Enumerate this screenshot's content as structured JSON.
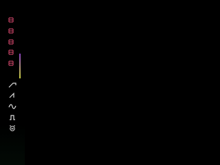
{
  "colors": {
    "background": "#000000",
    "channel_icon_stroke": "#e34c74",
    "wave_icon_stroke": "#dcdcdc",
    "meter_top": "#8b3fc2",
    "meter_bottom": "#c8d23e",
    "top_strip": "#0b3a16"
  },
  "sidebar": {
    "channel_buttons": [
      {
        "icon": "channel-icon"
      },
      {
        "icon": "channel-icon"
      },
      {
        "icon": "channel-icon"
      },
      {
        "icon": "channel-icon"
      },
      {
        "icon": "channel-icon"
      }
    ],
    "level_meter": {
      "level": 1.0
    },
    "waveform_buttons": [
      {
        "icon": "sawtooth-wave-icon"
      },
      {
        "icon": "ramp-wave-icon"
      },
      {
        "icon": "sine-wave-icon"
      },
      {
        "icon": "square-wave-icon"
      },
      {
        "icon": "noise-icon"
      }
    ]
  }
}
